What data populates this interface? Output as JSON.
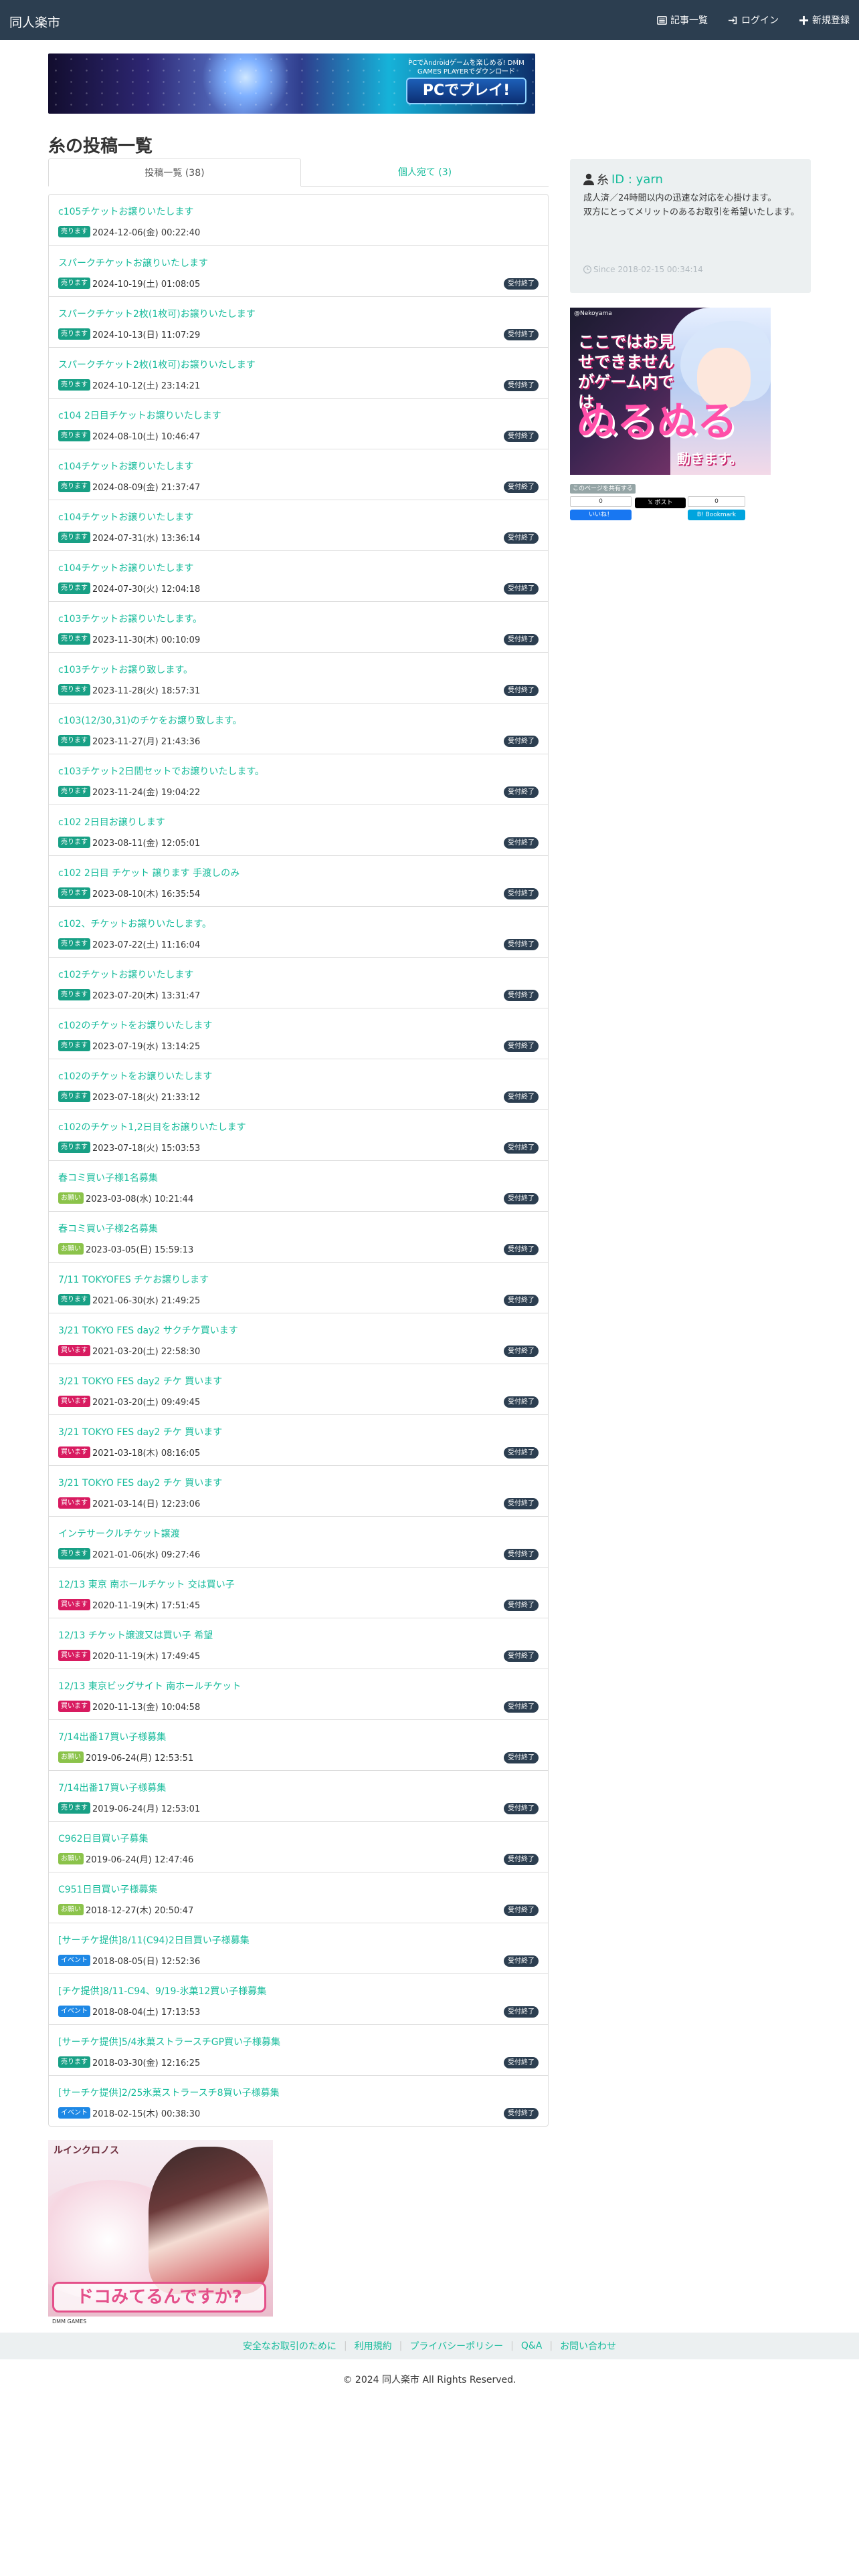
{
  "navbar": {
    "brand": "同人楽市",
    "links": [
      {
        "label": "記事一覧",
        "icon": "list-icon"
      },
      {
        "label": "ログイン",
        "icon": "login-icon"
      },
      {
        "label": "新規登録",
        "icon": "plus-icon"
      }
    ]
  },
  "banner_top": {
    "copy": "PCでAndroidゲームを楽しめる! DMM GAMES PLAYERでダウンロード",
    "cta": "PCでプレイ!"
  },
  "page": {
    "title": "糸の投稿一覧"
  },
  "tabs": [
    {
      "label": "投稿一覧 (38)"
    },
    {
      "label": "個人宛て (3)"
    }
  ],
  "type_colors": {
    "売ります": "#18a085",
    "買います": "#d81b60",
    "お願い": "#8bc34a",
    "イベント": "#1e88e5"
  },
  "posts": [
    {
      "title": "c105チケットお譲りいたします",
      "type": "売ります",
      "date": "2024-12-06(金) 00:22:40",
      "status": ""
    },
    {
      "title": "スパークチケットお譲りいたします",
      "type": "売ります",
      "date": "2024-10-19(土) 01:08:05",
      "status": "受付終了"
    },
    {
      "title": "スパークチケット2枚(1枚可)お譲りいたします",
      "type": "売ります",
      "date": "2024-10-13(日) 11:07:29",
      "status": "受付終了"
    },
    {
      "title": "スパークチケット2枚(1枚可)お譲りいたします",
      "type": "売ります",
      "date": "2024-10-12(土) 23:14:21",
      "status": "受付終了"
    },
    {
      "title": "c104 2日目チケットお譲りいたします",
      "type": "売ります",
      "date": "2024-08-10(土) 10:46:47",
      "status": "受付終了"
    },
    {
      "title": "c104チケットお譲りいたします",
      "type": "売ります",
      "date": "2024-08-09(金) 21:37:47",
      "status": "受付終了"
    },
    {
      "title": "c104チケットお譲りいたします",
      "type": "売ります",
      "date": "2024-07-31(水) 13:36:14",
      "status": "受付終了"
    },
    {
      "title": "c104チケットお譲りいたします",
      "type": "売ります",
      "date": "2024-07-30(火) 12:04:18",
      "status": "受付終了"
    },
    {
      "title": "c103チケットお譲りいたします。",
      "type": "売ります",
      "date": "2023-11-30(木) 00:10:09",
      "status": "受付終了"
    },
    {
      "title": "c103チケットお譲り致します。",
      "type": "売ります",
      "date": "2023-11-28(火) 18:57:31",
      "status": "受付終了"
    },
    {
      "title": "c103(12/30,31)のチケをお譲り致します。",
      "type": "売ります",
      "date": "2023-11-27(月) 21:43:36",
      "status": "受付終了"
    },
    {
      "title": "c103チケット2日間セットでお譲りいたします。",
      "type": "売ります",
      "date": "2023-11-24(金) 19:04:22",
      "status": "受付終了"
    },
    {
      "title": "c102 2日目お譲りします",
      "type": "売ります",
      "date": "2023-08-11(金) 12:05:01",
      "status": "受付終了"
    },
    {
      "title": "c102 2日目 チケット 譲ります 手渡しのみ",
      "type": "売ります",
      "date": "2023-08-10(木) 16:35:54",
      "status": "受付終了"
    },
    {
      "title": "c102、チケットお譲りいたします。",
      "type": "売ります",
      "date": "2023-07-22(土) 11:16:04",
      "status": "受付終了"
    },
    {
      "title": "c102チケットお譲りいたします",
      "type": "売ります",
      "date": "2023-07-20(木) 13:31:47",
      "status": "受付終了"
    },
    {
      "title": "c102のチケットをお譲りいたします",
      "type": "売ります",
      "date": "2023-07-19(水) 13:14:25",
      "status": "受付終了"
    },
    {
      "title": "c102のチケットをお譲りいたします",
      "type": "売ります",
      "date": "2023-07-18(火) 21:33:12",
      "status": "受付終了"
    },
    {
      "title": "c102のチケット1,2日目をお譲りいたします",
      "type": "売ります",
      "date": "2023-07-18(火) 15:03:53",
      "status": "受付終了"
    },
    {
      "title": "春コミ買い子様1名募集",
      "type": "お願い",
      "date": "2023-03-08(水) 10:21:44",
      "status": "受付終了"
    },
    {
      "title": "春コミ買い子様2名募集",
      "type": "お願い",
      "date": "2023-03-05(日) 15:59:13",
      "status": "受付終了"
    },
    {
      "title": "7/11 TOKYOFES チケお譲りします",
      "type": "売ります",
      "date": "2021-06-30(水) 21:49:25",
      "status": "受付終了"
    },
    {
      "title": "3/21 TOKYO FES day2 サクチケ買います",
      "type": "買います",
      "date": "2021-03-20(土) 22:58:30",
      "status": "受付終了"
    },
    {
      "title": "3/21 TOKYO FES day2 チケ 買います",
      "type": "買います",
      "date": "2021-03-20(土) 09:49:45",
      "status": "受付終了"
    },
    {
      "title": "3/21 TOKYO FES day2 チケ 買います",
      "type": "買います",
      "date": "2021-03-18(木) 08:16:05",
      "status": "受付終了"
    },
    {
      "title": "3/21 TOKYO FES day2 チケ 買います",
      "type": "買います",
      "date": "2021-03-14(日) 12:23:06",
      "status": "受付終了"
    },
    {
      "title": "インテサークルチケット譲渡",
      "type": "売ります",
      "date": "2021-01-06(水) 09:27:46",
      "status": "受付終了"
    },
    {
      "title": "12/13 東京 南ホールチケット 交は買い子",
      "type": "買います",
      "date": "2020-11-19(木) 17:51:45",
      "status": "受付終了"
    },
    {
      "title": "12/13 チケット譲渡又は買い子 希望",
      "type": "買います",
      "date": "2020-11-19(木) 17:49:45",
      "status": "受付終了"
    },
    {
      "title": "12/13 東京ビッグサイト 南ホールチケット",
      "type": "買います",
      "date": "2020-11-13(金) 10:04:58",
      "status": "受付終了"
    },
    {
      "title": "7/14出番17買い子様募集",
      "type": "お願い",
      "date": "2019-06-24(月) 12:53:51",
      "status": "受付終了"
    },
    {
      "title": "7/14出番17買い子様募集",
      "type": "売ります",
      "date": "2019-06-24(月) 12:53:01",
      "status": "受付終了"
    },
    {
      "title": "C962日目買い子募集",
      "type": "お願い",
      "date": "2019-06-24(月) 12:47:46",
      "status": "受付終了"
    },
    {
      "title": "C951日目買い子様募集",
      "type": "お願い",
      "date": "2018-12-27(木) 20:50:47",
      "status": "受付終了"
    },
    {
      "title": "[サーチケ提供]8/11(C94)2日目買い子様募集",
      "type": "イベント",
      "date": "2018-08-05(日) 12:52:36",
      "status": "受付終了"
    },
    {
      "title": "[チケ提供]8/11-C94、9/19-氷菓12買い子様募集",
      "type": "イベント",
      "date": "2018-08-04(土) 17:13:53",
      "status": "受付終了"
    },
    {
      "title": "[サーチケ提供]5/4氷菓ストラースチGP買い子様募集",
      "type": "売ります",
      "date": "2018-03-30(金) 12:16:25",
      "status": "受付終了"
    },
    {
      "title": "[サーチケ提供]2/25氷菓ストラースチ8買い子様募集",
      "type": "イベント",
      "date": "2018-02-15(木) 00:38:30",
      "status": "受付終了"
    }
  ],
  "profile": {
    "name": "糸",
    "id_label": "ID : yarn",
    "description": [
      "成人済／24時間以内の迅速な対応を心掛けます。",
      "双方にとってメリットのあるお取引を希望いたします。"
    ],
    "since": "Since 2018-02-15 00:34:14"
  },
  "side_banner": {
    "small": "@Nekoyama",
    "headline": "ここではお見せできませんがゲーム内では",
    "big": "ぬるぬる",
    "tail": "動きます。"
  },
  "share": {
    "label": "このページを共有する",
    "fb_count": "0",
    "hb_count": "0",
    "fb_label": "いいね！",
    "x_label": "ポスト",
    "hb_label": "Bookmark"
  },
  "bottom_banner": {
    "logo": "ルインクロノス",
    "tag": "ドコみてるんですか?",
    "strip": "DMM GAMES"
  },
  "footer": {
    "links": [
      "安全なお取引のために",
      "利用規約",
      "プライバシーポリシー",
      "Q&A",
      "お問い合わせ"
    ],
    "copyright": "© 2024 同人楽市 All Rights Reserved."
  }
}
